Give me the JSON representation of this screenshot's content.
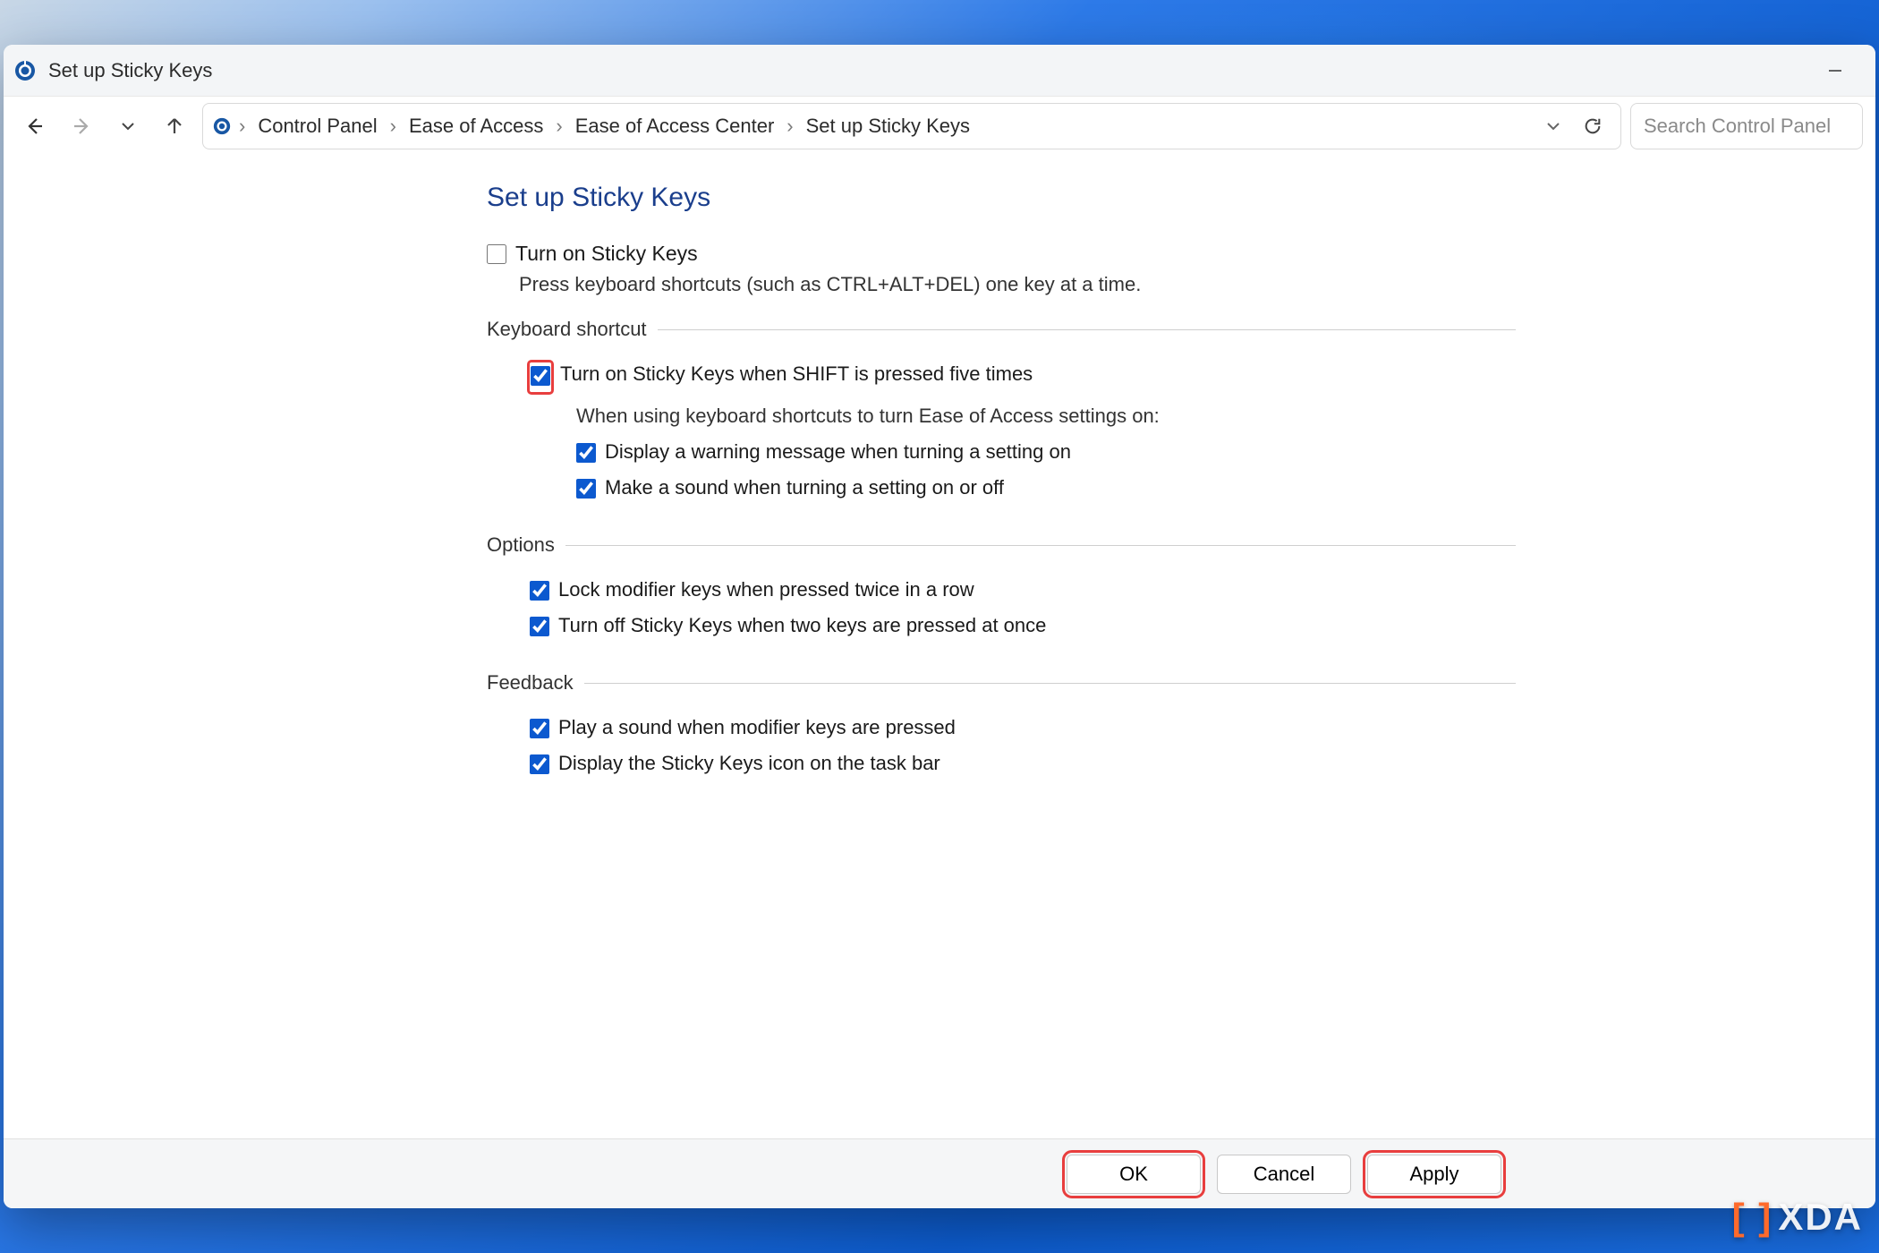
{
  "window": {
    "title": "Set up Sticky Keys"
  },
  "breadcrumbs": {
    "items": [
      "Control Panel",
      "Ease of Access",
      "Ease of Access Center",
      "Set up Sticky Keys"
    ]
  },
  "search": {
    "placeholder": "Search Control Panel"
  },
  "page": {
    "heading": "Set up Sticky Keys",
    "turn_on_label": "Turn on Sticky Keys",
    "turn_on_desc": "Press keyboard shortcuts (such as CTRL+ALT+DEL) one key at a time.",
    "turn_on_checked": false
  },
  "keyboard_shortcut": {
    "legend": "Keyboard shortcut",
    "shift5_label": "Turn on Sticky Keys when SHIFT is pressed five times",
    "shift5_checked": true,
    "subtext": "When using keyboard shortcuts to turn Ease of Access settings on:",
    "warn_label": "Display a warning message when turning a setting on",
    "warn_checked": true,
    "sound_label": "Make a sound when turning a setting on or off",
    "sound_checked": true
  },
  "options": {
    "legend": "Options",
    "lock_label": "Lock modifier keys when pressed twice in a row",
    "lock_checked": true,
    "turnoff_label": "Turn off Sticky Keys when two keys are pressed at once",
    "turnoff_checked": true
  },
  "feedback": {
    "legend": "Feedback",
    "playsound_label": "Play a sound when modifier keys are pressed",
    "playsound_checked": true,
    "taskbar_label": "Display the Sticky Keys icon on the task bar",
    "taskbar_checked": true
  },
  "buttons": {
    "ok": "OK",
    "cancel": "Cancel",
    "apply": "Apply"
  },
  "watermark": {
    "text": "XDA"
  }
}
